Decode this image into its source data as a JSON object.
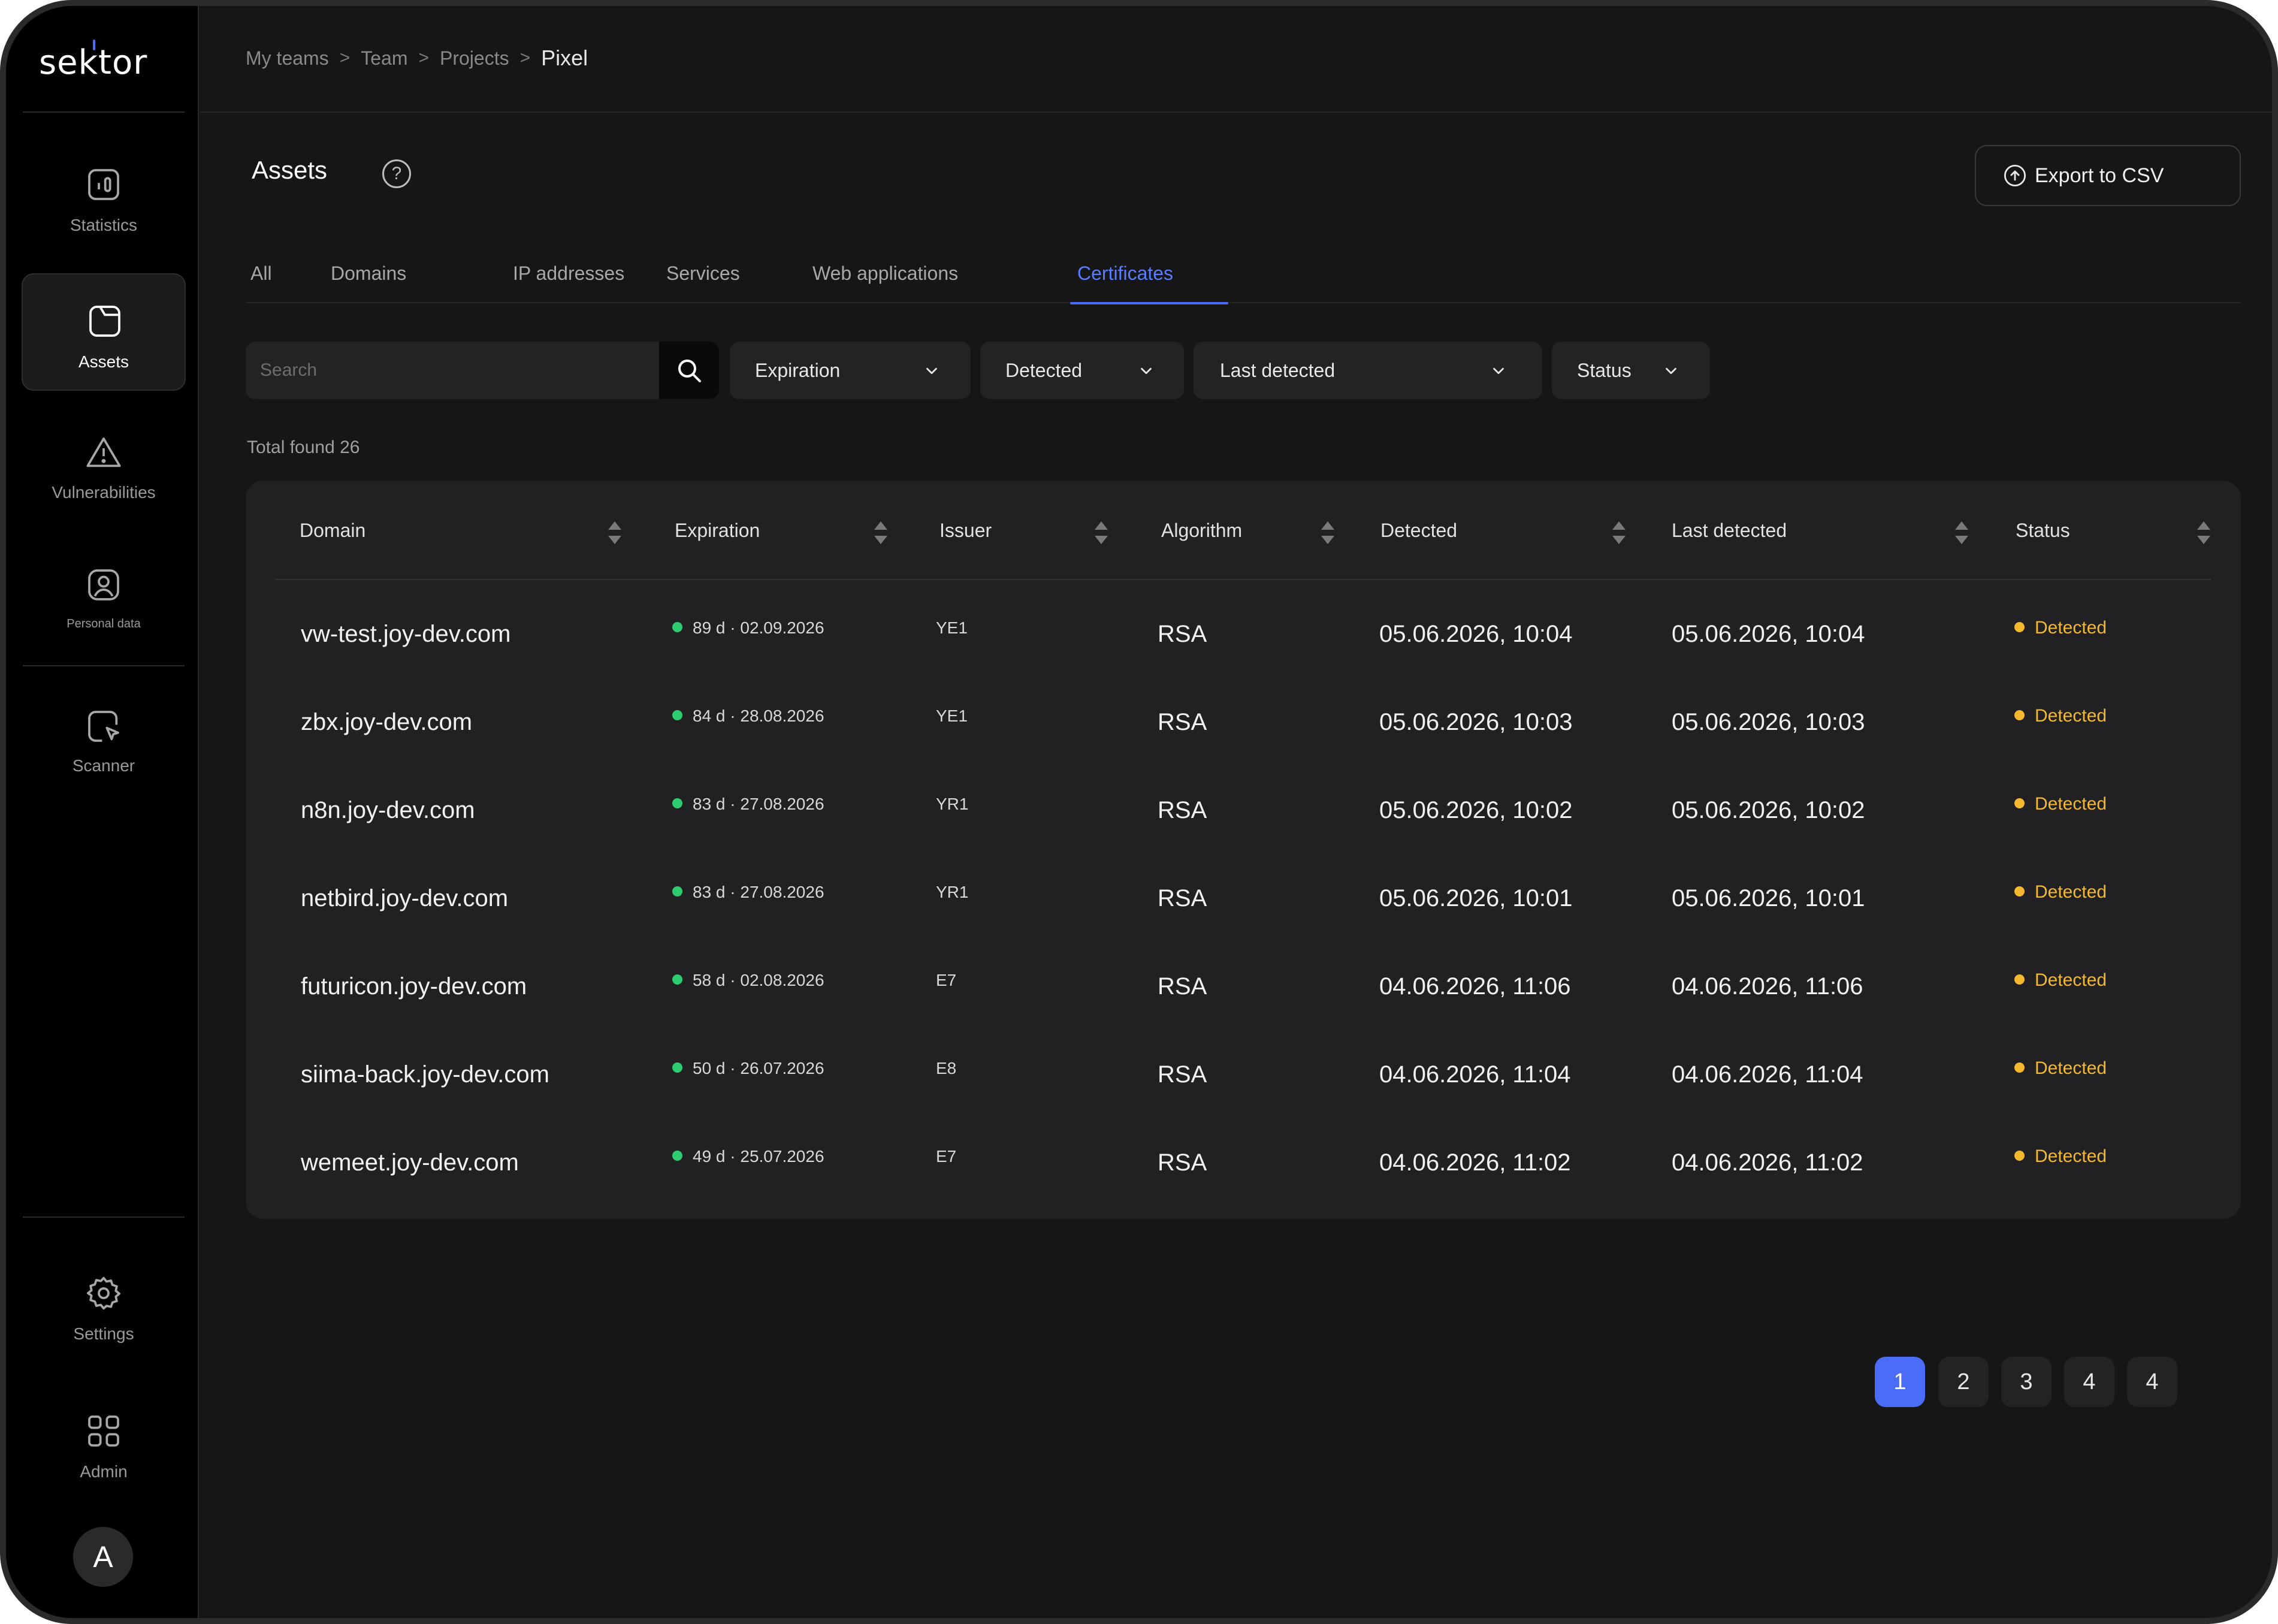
{
  "app": {
    "logo_text": "sektor"
  },
  "sidebar": {
    "items": [
      {
        "label": "Statistics",
        "icon": "statistics-icon"
      },
      {
        "label": "Assets",
        "icon": "assets-icon",
        "active": true
      },
      {
        "label": "Vulnerabilities",
        "icon": "warning-icon"
      },
      {
        "label": "Personal data",
        "icon": "personal-data-icon"
      },
      {
        "label": "Scanner",
        "icon": "scanner-icon"
      },
      {
        "label": "Settings",
        "icon": "gear-icon"
      },
      {
        "label": "Admin",
        "icon": "grid-icon"
      }
    ],
    "avatar_initial": "A"
  },
  "breadcrumb": {
    "items": [
      "My teams",
      "Team",
      "Projects"
    ],
    "current": "Pixel",
    "separator": ">"
  },
  "page": {
    "title": "Assets",
    "help": "?",
    "export_label": "Export to CSV"
  },
  "tabs": [
    {
      "label": "All"
    },
    {
      "label": "Domains"
    },
    {
      "label": "IP addresses"
    },
    {
      "label": "Services"
    },
    {
      "label": "Web applications"
    },
    {
      "label": "Certificates",
      "active": true
    }
  ],
  "filters": {
    "search_placeholder": "Search",
    "expiration": "Expiration",
    "detected": "Detected",
    "last_detected": "Last detected",
    "status": "Status"
  },
  "total_found": "Total found 26",
  "table": {
    "columns": [
      "Domain",
      "Expiration",
      "Issuer",
      "Algorithm",
      "Detected",
      "Last detected",
      "Status"
    ],
    "rows": [
      {
        "domain": "vw-test.joy-dev.com",
        "expiration": "89 d · 02.09.2026",
        "issuer": "YE1",
        "algorithm": "RSA",
        "detected": "05.06.2026, 10:04",
        "last_detected": "05.06.2026, 10:04",
        "status": "Detected"
      },
      {
        "domain": "zbx.joy-dev.com",
        "expiration": "84 d · 28.08.2026",
        "issuer": "YE1",
        "algorithm": "RSA",
        "detected": "05.06.2026, 10:03",
        "last_detected": "05.06.2026, 10:03",
        "status": "Detected"
      },
      {
        "domain": "n8n.joy-dev.com",
        "expiration": "83 d · 27.08.2026",
        "issuer": "YR1",
        "algorithm": "RSA",
        "detected": "05.06.2026, 10:02",
        "last_detected": "05.06.2026, 10:02",
        "status": "Detected"
      },
      {
        "domain": "netbird.joy-dev.com",
        "expiration": "83 d · 27.08.2026",
        "issuer": "YR1",
        "algorithm": "RSA",
        "detected": "05.06.2026, 10:01",
        "last_detected": "05.06.2026, 10:01",
        "status": "Detected"
      },
      {
        "domain": "futuricon.joy-dev.com",
        "expiration": "58 d · 02.08.2026",
        "issuer": "E7",
        "algorithm": "RSA",
        "detected": "04.06.2026, 11:06",
        "last_detected": "04.06.2026, 11:06",
        "status": "Detected"
      },
      {
        "domain": "siima-back.joy-dev.com",
        "expiration": "50 d · 26.07.2026",
        "issuer": "E8",
        "algorithm": "RSA",
        "detected": "04.06.2026, 11:04",
        "last_detected": "04.06.2026, 11:04",
        "status": "Detected"
      },
      {
        "domain": "wemeet.joy-dev.com",
        "expiration": "49 d · 25.07.2026",
        "issuer": "E7",
        "algorithm": "RSA",
        "detected": "04.06.2026, 11:02",
        "last_detected": "04.06.2026, 11:02",
        "status": "Detected"
      }
    ]
  },
  "pagination": {
    "pages": [
      "1",
      "2",
      "3",
      "4",
      "4"
    ],
    "current": "1"
  },
  "colors": {
    "accent": "#4a6cf7",
    "expiration_ok": "#2ecc71",
    "status_detected": "#f5b82e",
    "background": "#161616",
    "sidebar": "#000000"
  }
}
